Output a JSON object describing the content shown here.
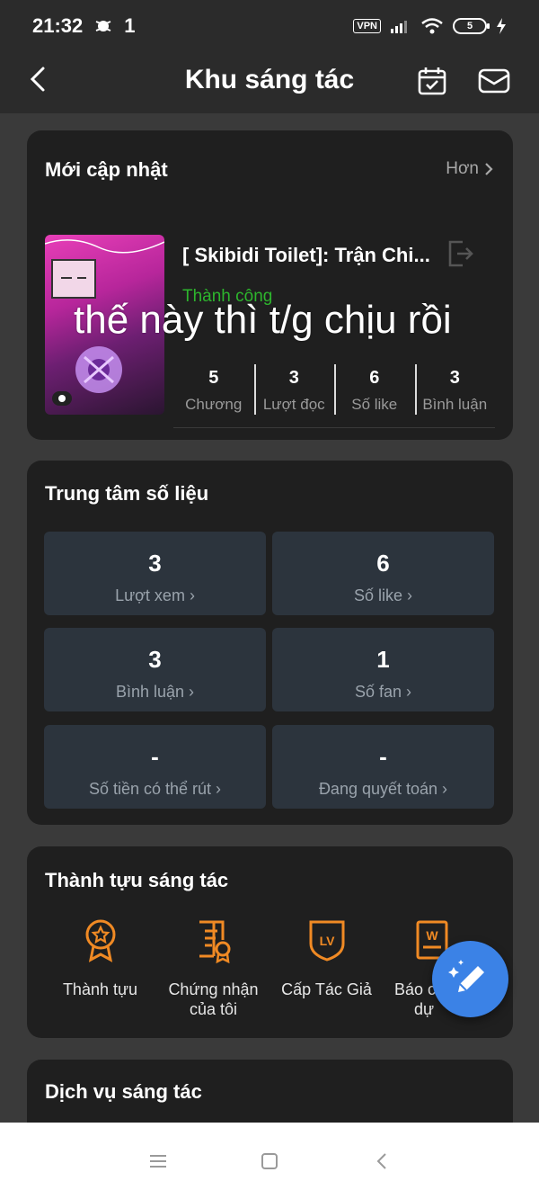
{
  "status_bar": {
    "time": "21:32",
    "notification_count": "1",
    "vpn_label": "VPN",
    "battery_level": "5"
  },
  "header": {
    "title": "Khu sáng tác",
    "back_icon": "chevron-left-icon",
    "calendar_icon": "calendar-check-icon",
    "mail_icon": "mail-icon"
  },
  "recent_update": {
    "title": "Mới cập nhật",
    "more_label": "Hơn",
    "story": {
      "title": "[ Skibidi Toilet]: Trận Chi...",
      "status": "Thành công",
      "overlay_caption": "thế này thì t/g chịu rồi",
      "stats": [
        {
          "value": "5",
          "label": "Chương"
        },
        {
          "value": "3",
          "label": "Lượt đọc"
        },
        {
          "value": "6",
          "label": "Số like"
        },
        {
          "value": "3",
          "label": "Bình luận"
        }
      ]
    }
  },
  "data_center": {
    "title": "Trung tâm số liệu",
    "tiles": [
      {
        "value": "3",
        "label": "Lượt xem"
      },
      {
        "value": "6",
        "label": "Số like"
      },
      {
        "value": "3",
        "label": "Bình luận"
      },
      {
        "value": "1",
        "label": "Số fan"
      },
      {
        "value": "-",
        "label": "Số tiền có thể rút"
      },
      {
        "value": "-",
        "label": "Đang quyết toán"
      }
    ]
  },
  "achievements": {
    "title": "Thành tựu sáng tác",
    "items": [
      {
        "label": "Thành tựu",
        "icon": "medal-icon"
      },
      {
        "label": "Chứng nhận của tôi",
        "icon": "certificate-icon"
      },
      {
        "label": "Cấp Tác Giả",
        "icon": "level-badge-icon"
      },
      {
        "label": "Báo cáo dự",
        "icon": "report-icon"
      }
    ]
  },
  "services": {
    "title": "Dịch vụ sáng tác"
  },
  "colors": {
    "accent_orange": "#f08a24",
    "success_green": "#2db52d",
    "fab_blue": "#3b82e6"
  }
}
